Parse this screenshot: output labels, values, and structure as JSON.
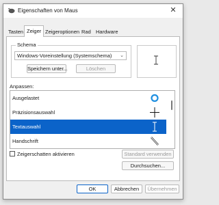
{
  "window": {
    "title": "Eigenschaften von Maus",
    "close": "✕"
  },
  "tabs": [
    {
      "label": "Tasten"
    },
    {
      "label": "Zeiger",
      "active": true
    },
    {
      "label": "Zeigeroptionen"
    },
    {
      "label": "Rad"
    },
    {
      "label": "Hardware"
    }
  ],
  "schema": {
    "group_label": "Schema",
    "selected": "Windows-Voreinstellung (Systemschema)",
    "save_label": "Speichern unter...",
    "delete_label": "Löschen"
  },
  "customize": {
    "label": "Anpassen:",
    "items": [
      {
        "label": "Ausgelastet",
        "icon": "busy-ring-icon"
      },
      {
        "label": "Präzisionsauswahl",
        "icon": "crosshair-icon"
      },
      {
        "label": "Textauswahl",
        "icon": "text-beam-icon",
        "selected": true
      },
      {
        "label": "Handschrift",
        "icon": "pen-icon"
      }
    ]
  },
  "shadow_checkbox": {
    "label": "Zeigerschatten aktivieren",
    "checked": false
  },
  "default_button": "Standard verwenden",
  "browse_button": "Durchsuchen...",
  "footer": {
    "ok": "OK",
    "cancel": "Abbrechen",
    "apply": "Übernehmen"
  },
  "colors": {
    "accent": "#0b63c9",
    "busy_icon": "#1e8fe0"
  }
}
